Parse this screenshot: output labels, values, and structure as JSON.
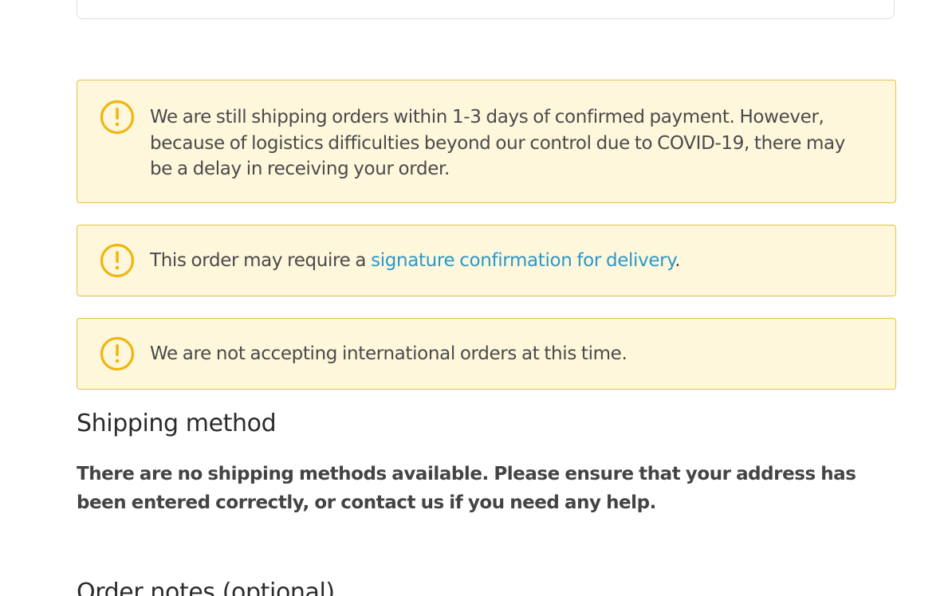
{
  "notices": [
    {
      "icon": "exclamation-circle-icon",
      "text": "We are still shipping orders within 1-3 days of confirmed payment. However, because of logistics difficulties beyond our control due to COVID-19, there may be a delay in receiving your order."
    },
    {
      "icon": "exclamation-circle-icon",
      "text_before": "This order may require a ",
      "link_text": "signature confirmation for delivery",
      "text_after": "."
    },
    {
      "icon": "exclamation-circle-icon",
      "text": "We are not accepting international orders at this time."
    }
  ],
  "shipping": {
    "title": "Shipping method",
    "message": "There are no shipping methods available. Please ensure that your address has been entered correctly, or contact us if you need any help."
  },
  "order_notes": {
    "title": "Order notes (optional)"
  },
  "colors": {
    "notice_background": "#fef7dc",
    "notice_border": "#e3c14b",
    "icon_color": "#f0b50f",
    "link_color": "#2c98c7"
  }
}
